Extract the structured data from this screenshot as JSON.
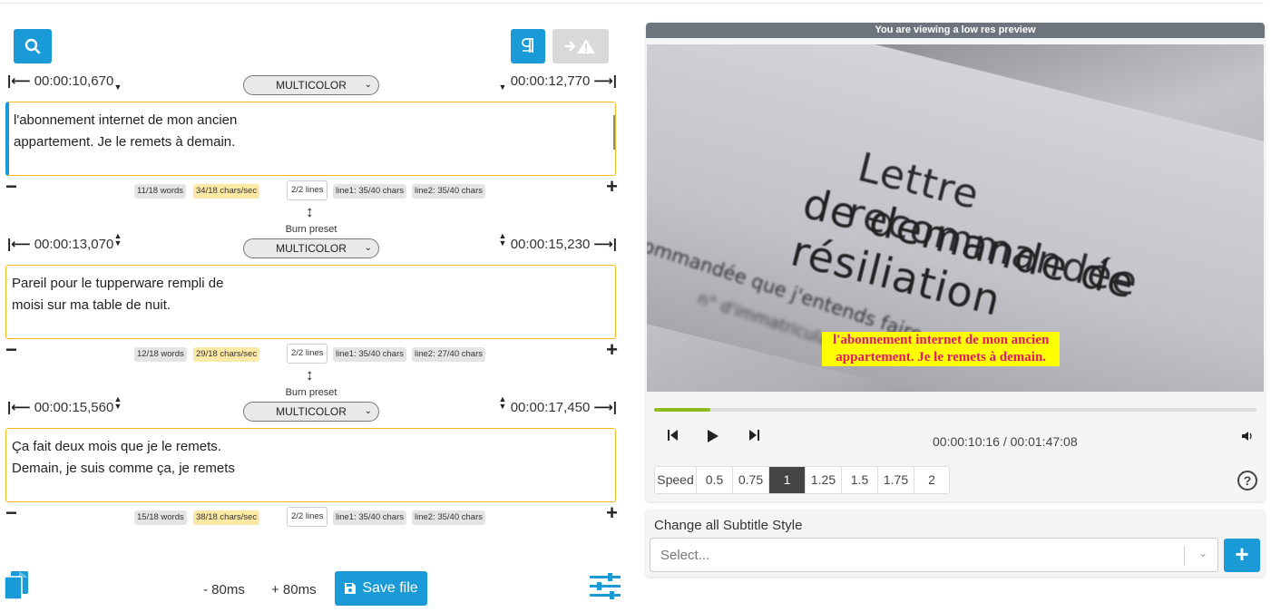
{
  "toolbar": {
    "search_icon": "search-icon",
    "pilcrow_icon": "pilcrow-icon",
    "warning_icon": "arrow-warning-icon"
  },
  "subtitles": [
    {
      "start": "00:00:10,670",
      "end": "00:00:12,770",
      "preset": "MULTICOLOR",
      "burn_label": "",
      "line1": "l'abonnement internet de mon ancien",
      "line2": "appartement. Je le remets à demain.",
      "words": "11/18 words",
      "cps": "34/18 chars/sec",
      "lines": "2/2 lines",
      "line1_chars": "line1: 35/40 chars",
      "line2_chars": "line2: 35/40 chars"
    },
    {
      "start": "00:00:13,070",
      "end": "00:00:15,230",
      "preset": "MULTICOLOR",
      "burn_label": "Burn preset",
      "line1": "Pareil pour le tupperware rempli de",
      "line2": "moisi sur ma table de nuit.",
      "words": "12/18 words",
      "cps": "29/18 chars/sec",
      "lines": "2/2 lines",
      "line1_chars": "line1: 35/40 chars",
      "line2_chars": "line2: 27/40 chars"
    },
    {
      "start": "00:00:15,560",
      "end": "00:00:17,450",
      "preset": "MULTICOLOR",
      "burn_label": "Burn preset",
      "line1": "Ça fait deux mois que je le remets.",
      "line2": "Demain, je suis comme ça, je remets",
      "words": "15/18 words",
      "cps": "38/18 chars/sec",
      "lines": "2/2 lines",
      "line1_chars": "line1: 35/40 chars",
      "line2_chars": "line2: 35/40 chars"
    }
  ],
  "bottom": {
    "minus_shift": "- 80ms",
    "plus_shift": "+ 80ms",
    "save_label": "Save file"
  },
  "video": {
    "banner": "You are viewing a low res preview",
    "frame_text_1": "Lettre recommandée",
    "frame_text_2": "de demande de résiliation",
    "frame_text_3": "ommandée que j'entends faire",
    "frame_text_4": "n° d'immatriculation",
    "burned_line1": "l'abonnement internet de mon ancien",
    "burned_line2": "appartement. Je le remets à demain.",
    "progress": 0.094,
    "current_time": "00:00:10:16",
    "duration": "00:01:47:08",
    "time_separator": " / ",
    "speed_label": "Speed",
    "speeds": [
      "0.5",
      "0.75",
      "1",
      "1.25",
      "1.5",
      "1.75",
      "2"
    ],
    "selected_speed": "1"
  },
  "style_panel": {
    "title": "Change all Subtitle Style",
    "placeholder": "Select..."
  },
  "colors": {
    "accent": "#1a9bd7",
    "warn_border": "#f5b622",
    "progress": "#8dbb1e",
    "subtitle_bg": "#ffff00",
    "subtitle_text": "#e5166b"
  }
}
